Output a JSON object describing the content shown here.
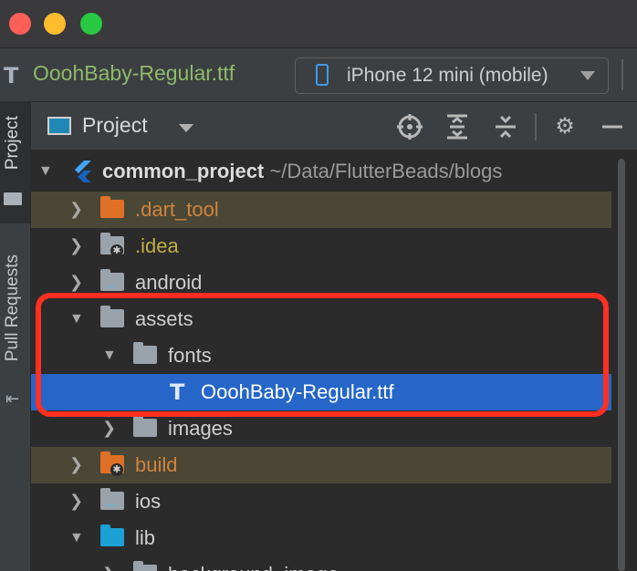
{
  "toolbar": {
    "file_icon": "T",
    "file_name": "OoohBaby-Regular.ttf",
    "device": "iPhone 12 mini (mobile)"
  },
  "side_strip": {
    "project_tab": "Project",
    "pull_requests_tab": "Pull Requests"
  },
  "panel": {
    "title": "Project",
    "icons": [
      "locate-icon",
      "expand-all-icon",
      "collapse-all-icon",
      "gear-icon",
      "hide-icon"
    ]
  },
  "tree": {
    "root": {
      "name": "common_project",
      "path": "~/Data/FlutterBeads/blogs"
    },
    "items": [
      {
        "label": ".dart_tool"
      },
      {
        "label": ".idea"
      },
      {
        "label": "android"
      },
      {
        "label": "assets"
      },
      {
        "label": "fonts"
      },
      {
        "label": "OoohBaby-Regular.ttf"
      },
      {
        "label": "images"
      },
      {
        "label": "build"
      },
      {
        "label": "ios"
      },
      {
        "label": "lib"
      },
      {
        "label": "background_image"
      }
    ]
  },
  "colors": {
    "selection": "#2566c8",
    "highlight_outline": "#ff2f21",
    "excluded_folder": "#e07026",
    "source_folder": "#1ba1d4"
  }
}
